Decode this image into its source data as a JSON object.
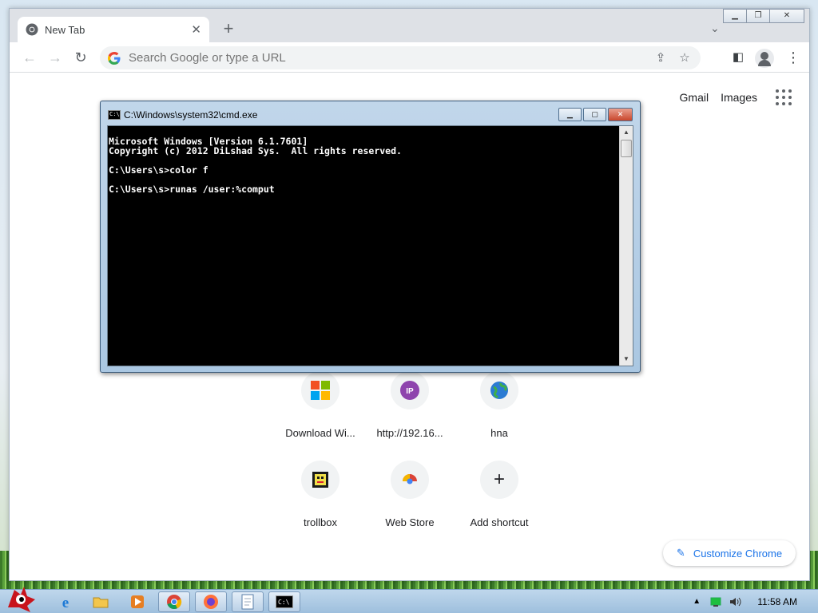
{
  "browser": {
    "tab_title": "New Tab",
    "omnibox_placeholder": "Search Google or type a URL"
  },
  "ntp": {
    "links": [
      "Gmail",
      "Images"
    ],
    "shortcuts": [
      {
        "label": "Download Wi...",
        "icon": "windows-logo-icon"
      },
      {
        "label": "http://192.16...",
        "icon": "ip-icon"
      },
      {
        "label": "hna",
        "icon": "globe-icon"
      },
      {
        "label": "trollbox",
        "icon": "trollbox-icon"
      },
      {
        "label": "Web Store",
        "icon": "chrome-web-store-icon"
      },
      {
        "label": "Add shortcut",
        "icon": "plus-icon"
      }
    ],
    "customize_label": "Customize Chrome"
  },
  "cmd": {
    "title": "C:\\Windows\\system32\\cmd.exe",
    "lines": [
      "Microsoft Windows [Version 6.1.7601]",
      "Copyright (c) 2012 DiLshad Sys.  All rights reserved.",
      "",
      "C:\\Users\\s>color f",
      "",
      "C:\\Users\\s>runas /user:%comput"
    ]
  },
  "taskbar": {
    "clock": "11:58 AM",
    "items": [
      "start-orb-icon",
      "internet-explorer-icon",
      "folder-icon",
      "media-player-icon",
      "chrome-icon",
      "firefox-icon",
      "notepad-icon",
      "cmd-icon"
    ]
  }
}
